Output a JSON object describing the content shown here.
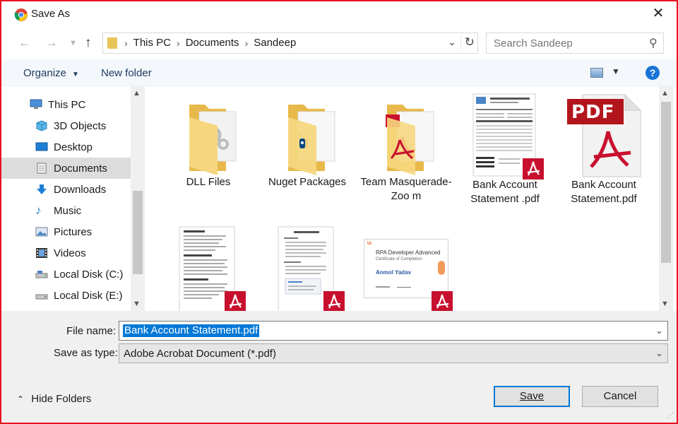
{
  "window": {
    "title": "Save As",
    "app_icon": "chrome-icon",
    "close_icon": "close-icon"
  },
  "navigation": {
    "back_icon": "back-arrow-icon",
    "forward_icon": "forward-arrow-icon",
    "recent_icon": "chevron-down-icon",
    "up_icon": "up-arrow-icon",
    "breadcrumbs": [
      "This PC",
      "Documents",
      "Sandeep"
    ],
    "search_placeholder": "Search Sandeep"
  },
  "toolbar": {
    "organize_label": "Organize",
    "new_folder_label": "New folder",
    "help_label": "?"
  },
  "nav_pane": {
    "items": [
      {
        "label": "This PC",
        "icon": "computer-icon"
      },
      {
        "label": "3D Objects",
        "icon": "cube-icon"
      },
      {
        "label": "Desktop",
        "icon": "desktop-icon"
      },
      {
        "label": "Documents",
        "icon": "documents-icon",
        "selected": true
      },
      {
        "label": "Downloads",
        "icon": "download-icon"
      },
      {
        "label": "Music",
        "icon": "music-icon"
      },
      {
        "label": "Pictures",
        "icon": "pictures-icon"
      },
      {
        "label": "Videos",
        "icon": "videos-icon"
      },
      {
        "label": "Local Disk (C:)",
        "icon": "disk-icon"
      },
      {
        "label": "Local Disk (E:)",
        "icon": "disk-icon"
      }
    ]
  },
  "files": [
    {
      "name": "DLL Files",
      "type": "folder",
      "overlay": "gears"
    },
    {
      "name": "Nuget Packages",
      "type": "folder",
      "overlay": "nuget"
    },
    {
      "name": "Team Masquerade-Zoo m",
      "type": "folder",
      "overlay": "pdf"
    },
    {
      "name": "Bank Account Statement .pdf",
      "type": "pdf-thumb"
    },
    {
      "name": "Bank Account Statement.pdf",
      "type": "pdf-icon",
      "icon_text": "PDF"
    },
    {
      "name": "",
      "type": "pdf-thumb"
    },
    {
      "name": "",
      "type": "pdf-thumb"
    },
    {
      "name": "",
      "type": "pdf-thumb-landscape",
      "cert_title": "RPA Developer Advanced",
      "cert_sub": "Certificate of Completion",
      "cert_name": "Anmol Yadav"
    }
  ],
  "form": {
    "file_name_label": "File name:",
    "file_name_value": "Bank Account Statement.pdf",
    "save_type_label": "Save as type:",
    "save_type_value": "Adobe Acrobat Document (*.pdf)",
    "hide_folders_label": "Hide Folders",
    "save_label": "Save",
    "cancel_label": "Cancel"
  },
  "colors": {
    "accent": "#0078d7",
    "pdf_red": "#c8102e",
    "folder": "#f3d27a",
    "window_border": "#e81123"
  }
}
